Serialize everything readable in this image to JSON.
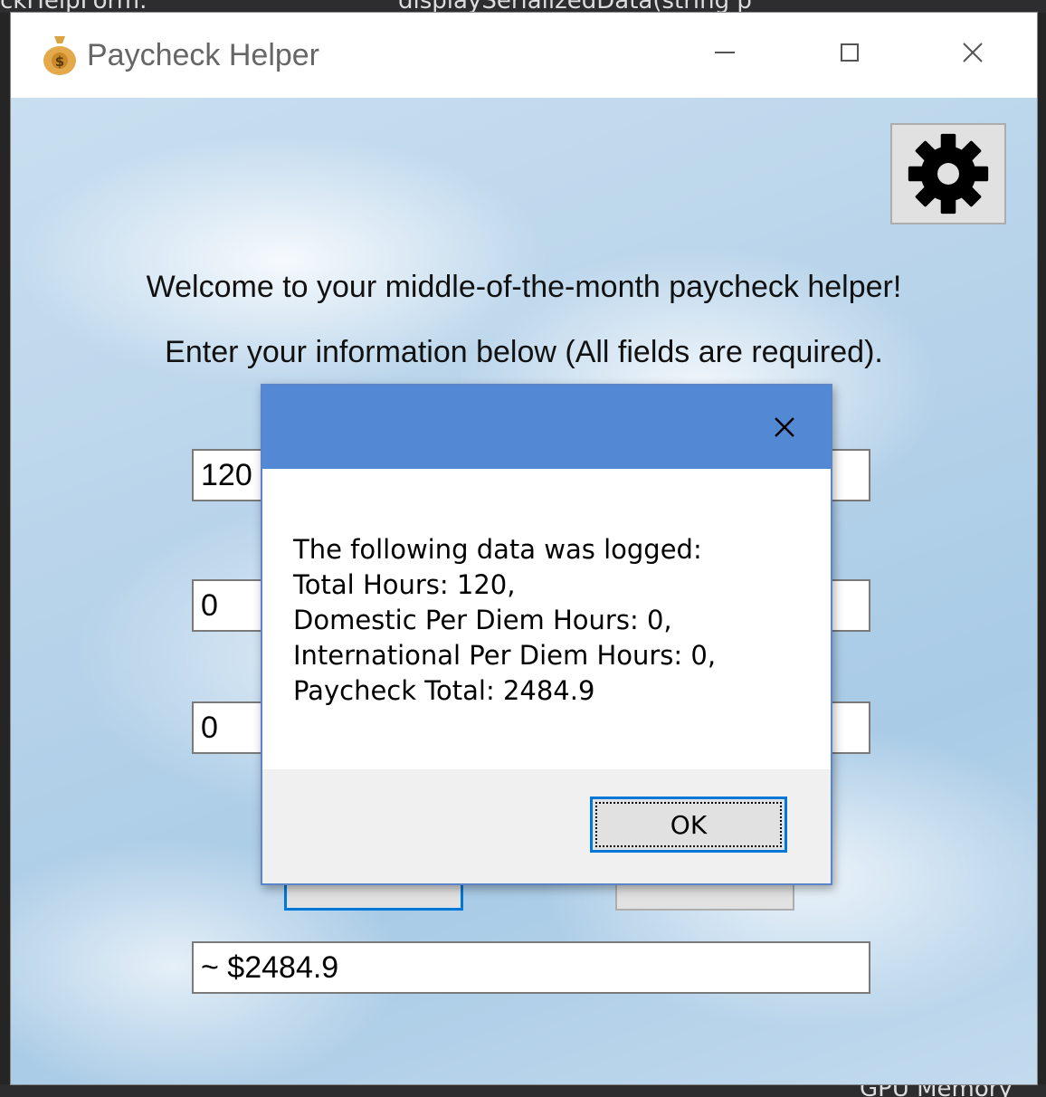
{
  "background": {
    "ide_top_left_fragment": "ckHelpForm.",
    "ide_top_mid_fragment": "displaySerializedData(string p",
    "ide_bottom_fragment": "GPU Memory"
  },
  "window": {
    "title": "Paycheck Helper",
    "icon": "money-bag-icon"
  },
  "main": {
    "welcome": "Welcome to your middle-of-the-month paycheck helper!",
    "instructions": "Enter your information below (All fields are required).",
    "fields": {
      "total_hours": "120",
      "domestic_per_diem_hours": "0",
      "international_per_diem_hours": "0",
      "result": "~ $2484.9"
    }
  },
  "dialog": {
    "lines": [
      "The following data was logged:",
      "Total Hours: 120,",
      "Domestic Per Diem Hours: 0,",
      "International Per Diem Hours: 0,",
      "Paycheck Total: 2484.9"
    ],
    "ok_label": "OK"
  },
  "colors": {
    "dialog_title": "#5288d4",
    "focus_border": "#0078d7"
  }
}
